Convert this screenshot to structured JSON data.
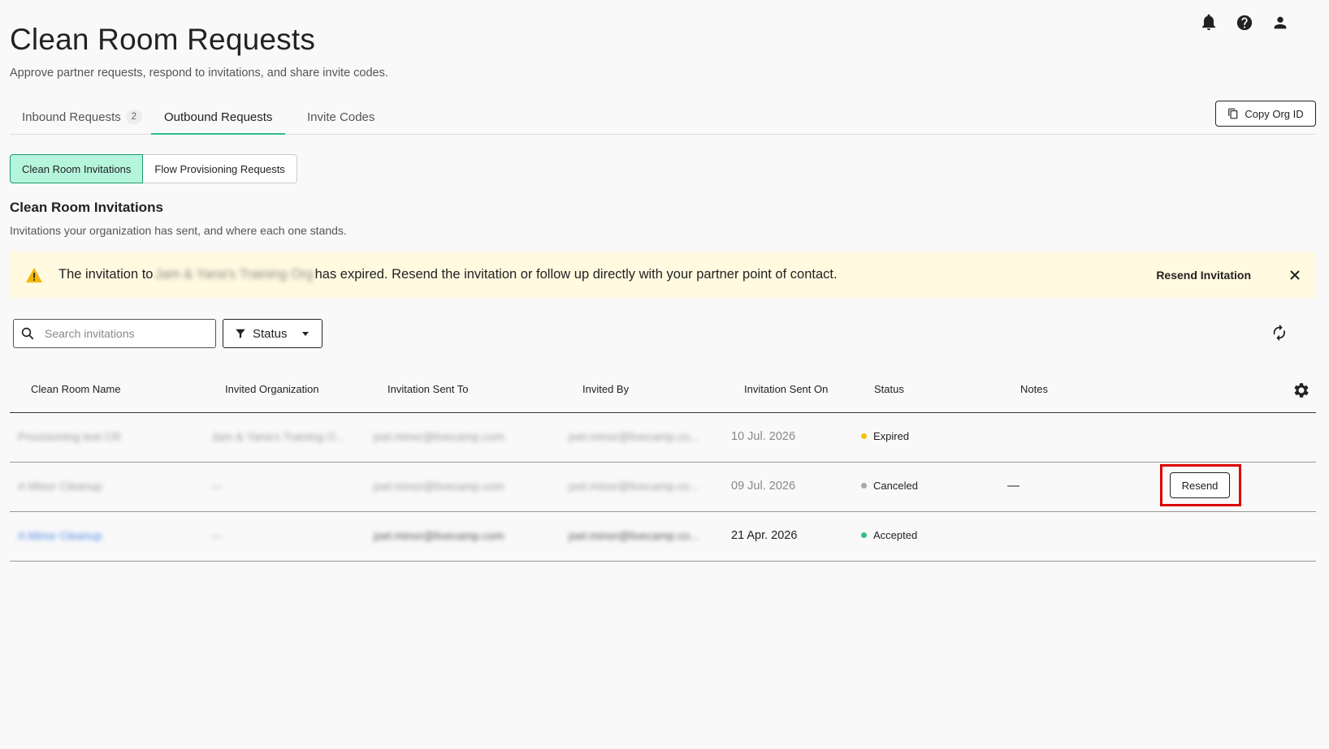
{
  "header": {
    "title": "Clean Room Requests",
    "subtitle": "Approve partner requests, respond to invitations, and share invite codes.",
    "icons": [
      "bell-icon",
      "help-icon",
      "user-icon"
    ]
  },
  "tabs": [
    {
      "label": "Inbound Requests",
      "count": "2",
      "active": false
    },
    {
      "label": "Outbound Requests",
      "active": true
    },
    {
      "label": "Invite Codes",
      "active": false
    }
  ],
  "copy_org_id_label": "Copy Org ID",
  "segments": [
    {
      "label": "Clean Room Invitations",
      "active": true
    },
    {
      "label": "Flow Provisioning Requests",
      "active": false
    }
  ],
  "section": {
    "title": "Clean Room Invitations",
    "subtitle": "Invitations your organization has sent, and where each one stands."
  },
  "alert": {
    "prefix": "The invitation to",
    "org": "Jam & Yana's Training Org",
    "suffix": "has expired. Resend the invitation or follow up directly with your partner point of contact.",
    "action": "Resend Invitation"
  },
  "search": {
    "placeholder": "Search invitations"
  },
  "filter": {
    "label": "Status"
  },
  "table": {
    "columns": [
      "Clean Room Name",
      "Invited Organization",
      "Invitation Sent To",
      "Invited By",
      "Invitation Sent On",
      "Status",
      "Notes"
    ],
    "rows": [
      {
        "name": "Provisioning test CR",
        "org": "Jam & Yana's Training O...",
        "sent_to": "joel.minor@livecamp.com",
        "invited_by": "joel.minor@livecamp.co...",
        "date": "10 Jul. 2026",
        "status": "Expired",
        "notes": "",
        "action": ""
      },
      {
        "name": "A Minor Cleanup",
        "org": "—",
        "sent_to": "joel.minor@livecamp.com",
        "invited_by": "joel.minor@livecamp.co...",
        "date": "09 Jul. 2026",
        "status": "Canceled",
        "notes": "—",
        "action": "Resend"
      },
      {
        "name": "A Minor Cleanup",
        "org": "—",
        "sent_to": "joel.minor@livecamp.com",
        "invited_by": "joel.minor@livecamp.co...",
        "date": "21 Apr. 2026",
        "status": "Accepted",
        "notes": "",
        "action": ""
      }
    ]
  },
  "colors": {
    "accent": "#2bbf8a",
    "active_segment_bg": "#b5f5dd",
    "alert_bg": "#fffae0",
    "expired": "#f2c200",
    "canceled": "#a8a8a8",
    "accepted": "#2ec27e",
    "highlight": "#dd0000"
  }
}
